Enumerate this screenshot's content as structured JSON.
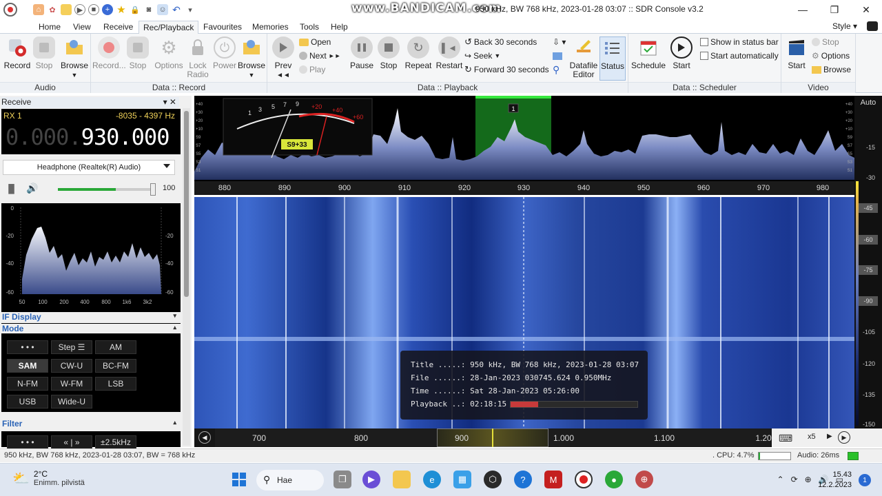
{
  "window": {
    "title": "950 kHz, BW 768 kHz, 2023-01-28 03:07 :: SDR Console v3.2",
    "watermark": "www.BANDICAM.com"
  },
  "menu": {
    "tabs": [
      "Home",
      "View",
      "Receive",
      "Rec/Playback",
      "Favourites",
      "Memories",
      "Tools",
      "Help"
    ],
    "active_tab": "Rec/Playback",
    "style_label": "Style"
  },
  "ribbon": {
    "audio": {
      "label": "Audio",
      "record": "Record",
      "stop": "Stop",
      "browse": "Browse"
    },
    "data_record": {
      "label": "Data :: Record",
      "record": "Record...",
      "stop": "Stop",
      "options": "Options",
      "lock_radio": "Lock Radio",
      "power": "Power",
      "browse": "Browse"
    },
    "data_playback": {
      "label": "Data :: Playback",
      "prev": "Prev",
      "open": "Open",
      "next": "Next",
      "play": "Play",
      "pause": "Pause",
      "stop": "Stop",
      "repeat": "Repeat",
      "restart": "Restart",
      "back30": "Back 30 seconds",
      "seek": "Seek",
      "forward30": "Forward 30 seconds",
      "datafile_editor": "Datafile Editor",
      "status": "Status"
    },
    "data_scheduler": {
      "label": "Data :: Scheduler",
      "schedule": "Schedule",
      "start": "Start",
      "show_in_status_bar": "Show in status bar",
      "start_automatically": "Start automatically"
    },
    "video": {
      "label": "Video",
      "start": "Start",
      "stop": "Stop",
      "options": "Options",
      "browse": "Browse"
    }
  },
  "receive_panel": {
    "title": "Receive",
    "rx_label": "RX 1",
    "range": "-8035 - 4397 Hz",
    "freq_dim": "0.000.",
    "freq_bright": "930.000",
    "audio_device": "Headphone (Realtek(R) Audio)",
    "volume": "100",
    "mini_spectrum": {
      "y_labels": [
        "0",
        "-20",
        "-40",
        "-60"
      ],
      "x_labels": [
        "50",
        "100",
        "200",
        "400",
        "800",
        "1k6",
        "3k2"
      ]
    },
    "if_display_label": "IF Display",
    "mode_label": "Mode",
    "modes": [
      "• • •",
      "Step ☰",
      "AM",
      "SAM",
      "CW-U",
      "BC-FM",
      "N-FM",
      "W-FM",
      "LSB",
      "USB",
      "Wide-U"
    ],
    "active_mode": "SAM",
    "filter_label": "Filter",
    "filter_buttons": [
      "• • •",
      "« | »",
      "±2.5kHz"
    ]
  },
  "spectrum": {
    "freq_labels": [
      "880",
      "890",
      "900",
      "910",
      "920",
      "930",
      "940",
      "950",
      "960",
      "970",
      "980"
    ],
    "marker_label": "1",
    "s_meter_labels": [
      "1",
      "3",
      "5",
      "7",
      "9",
      "+20",
      "+40",
      "+60"
    ],
    "s_meter_reading": "S9+33",
    "left_db_labels": [
      "+40",
      "+30",
      "+20",
      "+10",
      "S9",
      "S7",
      "S5",
      "S3",
      "S1"
    ],
    "right_db_labels": [
      "+40",
      "+30",
      "+20",
      "+10",
      "S9",
      "S7",
      "S5",
      "S3",
      "S1"
    ],
    "auto_label": "Auto"
  },
  "right_scale": {
    "labels": [
      "-15",
      "-30",
      "-105",
      "-120",
      "-135",
      "-150"
    ],
    "boxed": [
      "-45",
      "-60",
      "-75",
      "-90"
    ]
  },
  "info": {
    "title_label": "Title .....:",
    "title_value": "950 kHz, BW 768 kHz, 2023-01-28 03:07",
    "file_label": "File ......:",
    "file_value": "28-Jan-2023 030745.624 0.950MHz",
    "time_label": "Time ......:",
    "time_value": "Sat 28-Jan-2023 05:26:00",
    "playback_label": "Playback ..:",
    "playback_value": "02:18:15",
    "playback_progress": 0.22
  },
  "navigator": {
    "labels": [
      "700",
      "800",
      "900",
      "1.000",
      "1.100",
      "1.20"
    ],
    "zoom": "x5"
  },
  "status_bar": {
    "text": "950 kHz, BW 768 kHz, 2023-01-28 03:07, BW = 768 kHz",
    "cpu": ". CPU: 4.7%",
    "cpu_level": 0.047,
    "audio": "Audio: 26ms"
  },
  "taskbar": {
    "temp": "2°C",
    "weather": "Enimm. pilvistä",
    "search": "Hae",
    "time": "15.43",
    "date": "12.2.2023",
    "notifications": "1"
  },
  "colors": {
    "ribbon_bg": "#f5f6f7",
    "spectrum_bg": "#000000",
    "waterfall_base": "#0e2a78",
    "marker_green": "#22c22a",
    "meter_yellow": "#d8e63a"
  }
}
